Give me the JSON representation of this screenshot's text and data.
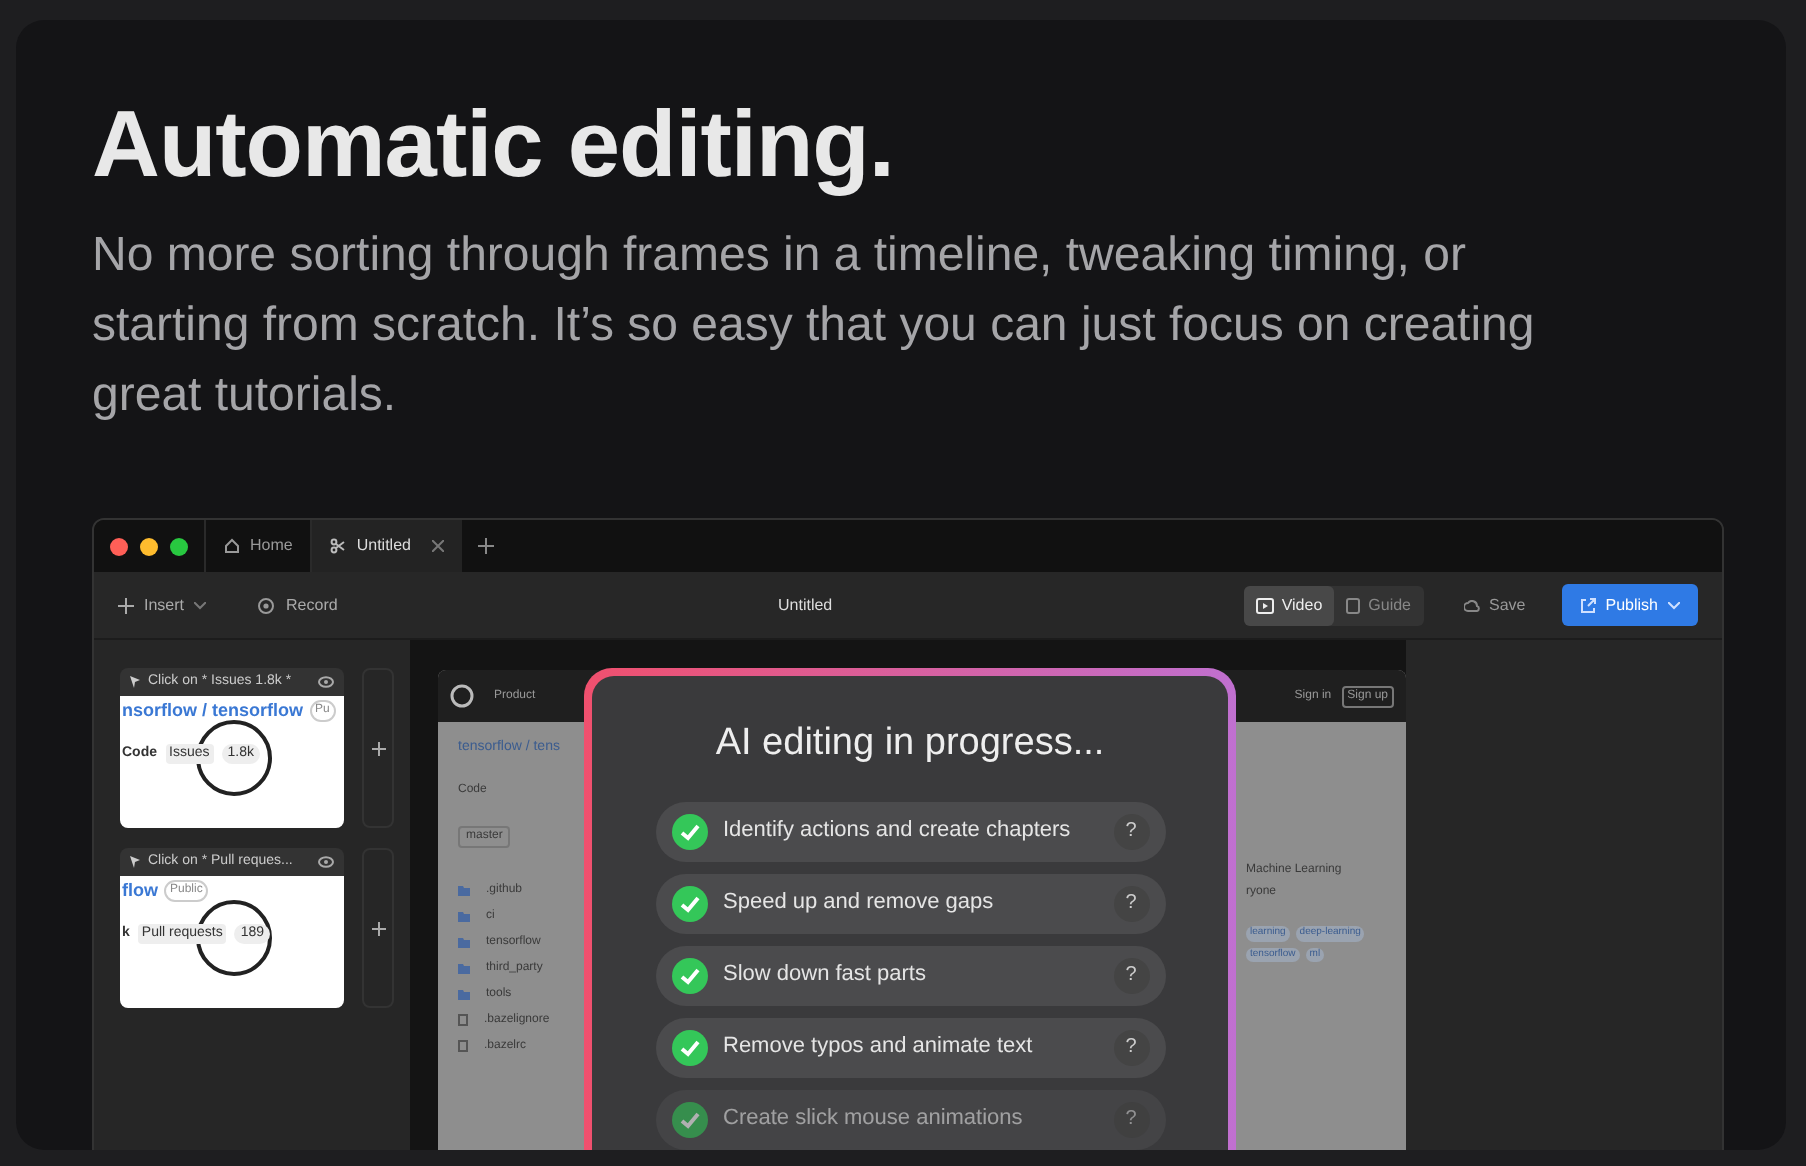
{
  "hero": {
    "title": "Automatic editing.",
    "subtitle": "No more sorting through frames in a timeline, tweaking timing, or starting from scratch. It’s so easy that you can just focus on creating great tutorials."
  },
  "app": {
    "tabs": [
      {
        "label": "Home",
        "selected": false,
        "closable": false
      },
      {
        "label": "Untitled",
        "selected": true,
        "closable": true
      }
    ],
    "toolbar": {
      "insert": "Insert",
      "record": "Record",
      "document_title": "Untitled",
      "view_modes": [
        {
          "label": "Video",
          "selected": true
        },
        {
          "label": "Guide",
          "selected": false
        }
      ],
      "save": "Save",
      "publish": "Publish"
    },
    "steps": [
      {
        "caption": "Click on * Issues 1.8k *",
        "thumb_title": "nsorflow / tensorflow",
        "thumb_badge": "Pu",
        "thumb_left": "Code",
        "thumb_label": "Issues",
        "thumb_count": "1.8k"
      },
      {
        "caption": "Click on * Pull reques...",
        "thumb_title": "flow",
        "thumb_badge": "Public",
        "thumb_left": "k",
        "thumb_label": "Pull requests",
        "thumb_count": "189"
      }
    ],
    "browser": {
      "nav": "Product",
      "sign_in": "Sign in",
      "sign_up": "Sign up",
      "repo": "tensorflow / tens",
      "code_tab": "Code",
      "branch": "master",
      "files": [
        {
          "name": ".github",
          "kind": "folder"
        },
        {
          "name": "ci",
          "kind": "folder"
        },
        {
          "name": "tensorflow",
          "kind": "folder"
        },
        {
          "name": "third_party",
          "kind": "folder"
        },
        {
          "name": "tools",
          "kind": "folder"
        },
        {
          "name": ".bazelignore",
          "kind": "file"
        },
        {
          "name": ".bazelrc",
          "kind": "file"
        }
      ],
      "about": [
        "Machine Learning",
        "ryone"
      ],
      "topics": [
        "learning",
        "deep-learning",
        "tensorflow",
        "ml"
      ]
    },
    "modal": {
      "title": "AI editing in progress...",
      "items": [
        {
          "label": "Identify actions and create chapters",
          "done": true,
          "faded": false
        },
        {
          "label": "Speed up and remove gaps",
          "done": true,
          "faded": false
        },
        {
          "label": "Slow down fast parts",
          "done": true,
          "faded": false
        },
        {
          "label": "Remove typos and animate text",
          "done": true,
          "faded": false
        },
        {
          "label": "Create slick mouse animations",
          "done": true,
          "faded": true
        }
      ],
      "help": "?"
    }
  }
}
